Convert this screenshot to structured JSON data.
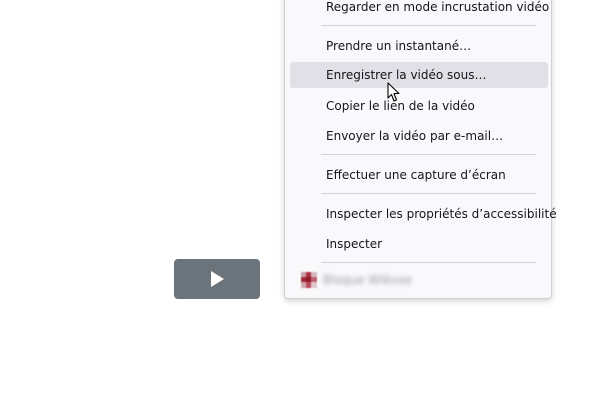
{
  "menu": {
    "items": [
      {
        "label": "Regarder en mode incrustation vidéo"
      },
      {
        "label": "Prendre un instantané…"
      },
      {
        "label": "Enregistrer la vidéo sous…"
      },
      {
        "label": "Copier le lien de la vidéo"
      },
      {
        "label": "Envoyer la vidéo par e-mail…"
      },
      {
        "label": "Effectuer une capture d’écran"
      },
      {
        "label": "Inspecter les propriétés d’accessibilité"
      },
      {
        "label": "Inspecter"
      }
    ],
    "hovered_item": "Enregistrer la vidéo sous…",
    "extension": {
      "label": "Bloque Wlèxxe",
      "icon": "extension-icon"
    }
  },
  "player": {
    "play_icon": "play-icon"
  },
  "colors": {
    "menu_bg": "#f9f9fb",
    "hover_bg": "#e0e0e6",
    "play_button_bg": "#6b737b"
  }
}
